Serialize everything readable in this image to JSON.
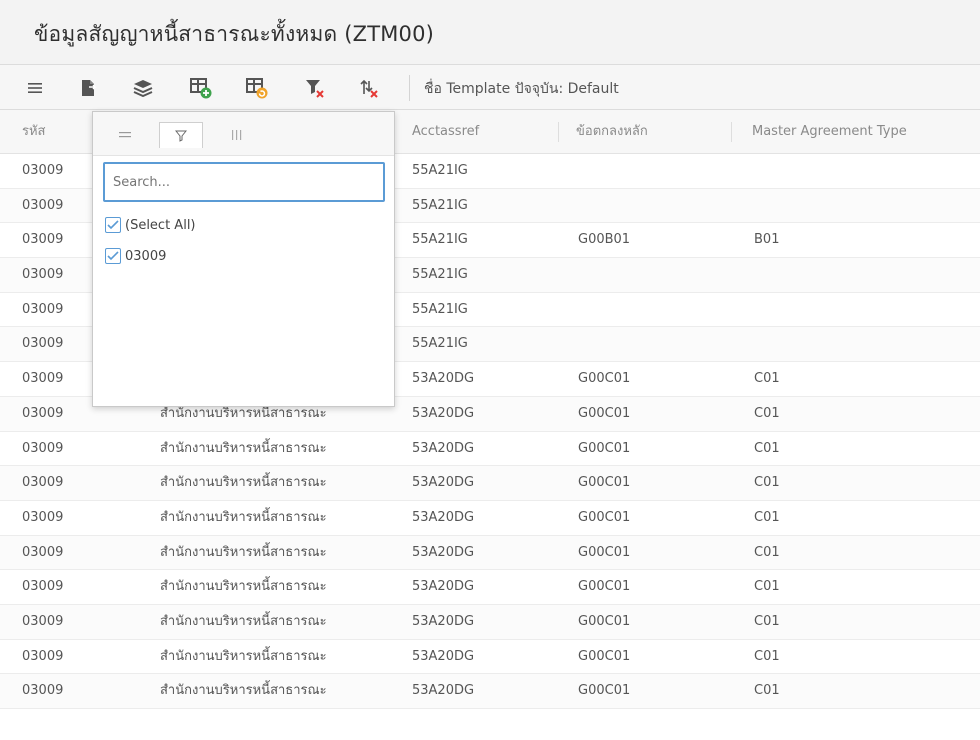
{
  "title": "ข้อมูลสัญญาหนี้สาธารณะทั้งหมด (ZTM00)",
  "toolbar": {
    "template_label": "ชื่อ Template ปัจจุบัน: Default",
    "icons": [
      "menu-icon",
      "export-icon",
      "layers-icon",
      "add-grid-icon",
      "edit-grid-icon",
      "clear-filter-icon",
      "clear-sort-icon"
    ]
  },
  "columns": [
    "รหัส",
    "Acctassref",
    "ข้อตกลงหลัก",
    "Master Agreement Type"
  ],
  "filter_popup": {
    "search_placeholder": "Search...",
    "items": [
      "(Select All)",
      "03009"
    ]
  },
  "rows": [
    {
      "code": "03009",
      "agency": "",
      "acctassref": "55A21IG",
      "main_agreement": "",
      "master_type": ""
    },
    {
      "code": "03009",
      "agency": "",
      "acctassref": "55A21IG",
      "main_agreement": "",
      "master_type": ""
    },
    {
      "code": "03009",
      "agency": "",
      "acctassref": "55A21IG",
      "main_agreement": "G00B01",
      "master_type": "B01"
    },
    {
      "code": "03009",
      "agency": "",
      "acctassref": "55A21IG",
      "main_agreement": "",
      "master_type": ""
    },
    {
      "code": "03009",
      "agency": "",
      "acctassref": "55A21IG",
      "main_agreement": "",
      "master_type": ""
    },
    {
      "code": "03009",
      "agency": "",
      "acctassref": "55A21IG",
      "main_agreement": "",
      "master_type": ""
    },
    {
      "code": "03009",
      "agency": "",
      "acctassref": "53A20DG",
      "main_agreement": "G00C01",
      "master_type": "C01"
    },
    {
      "code": "03009",
      "agency": "สำนักงานบริหารหนี้สาธารณะ",
      "acctassref": "53A20DG",
      "main_agreement": "G00C01",
      "master_type": "C01"
    },
    {
      "code": "03009",
      "agency": "สำนักงานบริหารหนี้สาธารณะ",
      "acctassref": "53A20DG",
      "main_agreement": "G00C01",
      "master_type": "C01"
    },
    {
      "code": "03009",
      "agency": "สำนักงานบริหารหนี้สาธารณะ",
      "acctassref": "53A20DG",
      "main_agreement": "G00C01",
      "master_type": "C01"
    },
    {
      "code": "03009",
      "agency": "สำนักงานบริหารหนี้สาธารณะ",
      "acctassref": "53A20DG",
      "main_agreement": "G00C01",
      "master_type": "C01"
    },
    {
      "code": "03009",
      "agency": "สำนักงานบริหารหนี้สาธารณะ",
      "acctassref": "53A20DG",
      "main_agreement": "G00C01",
      "master_type": "C01"
    },
    {
      "code": "03009",
      "agency": "สำนักงานบริหารหนี้สาธารณะ",
      "acctassref": "53A20DG",
      "main_agreement": "G00C01",
      "master_type": "C01"
    },
    {
      "code": "03009",
      "agency": "สำนักงานบริหารหนี้สาธารณะ",
      "acctassref": "53A20DG",
      "main_agreement": "G00C01",
      "master_type": "C01"
    },
    {
      "code": "03009",
      "agency": "สำนักงานบริหารหนี้สาธารณะ",
      "acctassref": "53A20DG",
      "main_agreement": "G00C01",
      "master_type": "C01"
    },
    {
      "code": "03009",
      "agency": "สำนักงานบริหารหนี้สาธารณะ",
      "acctassref": "53A20DG",
      "main_agreement": "G00C01",
      "master_type": "C01"
    }
  ]
}
